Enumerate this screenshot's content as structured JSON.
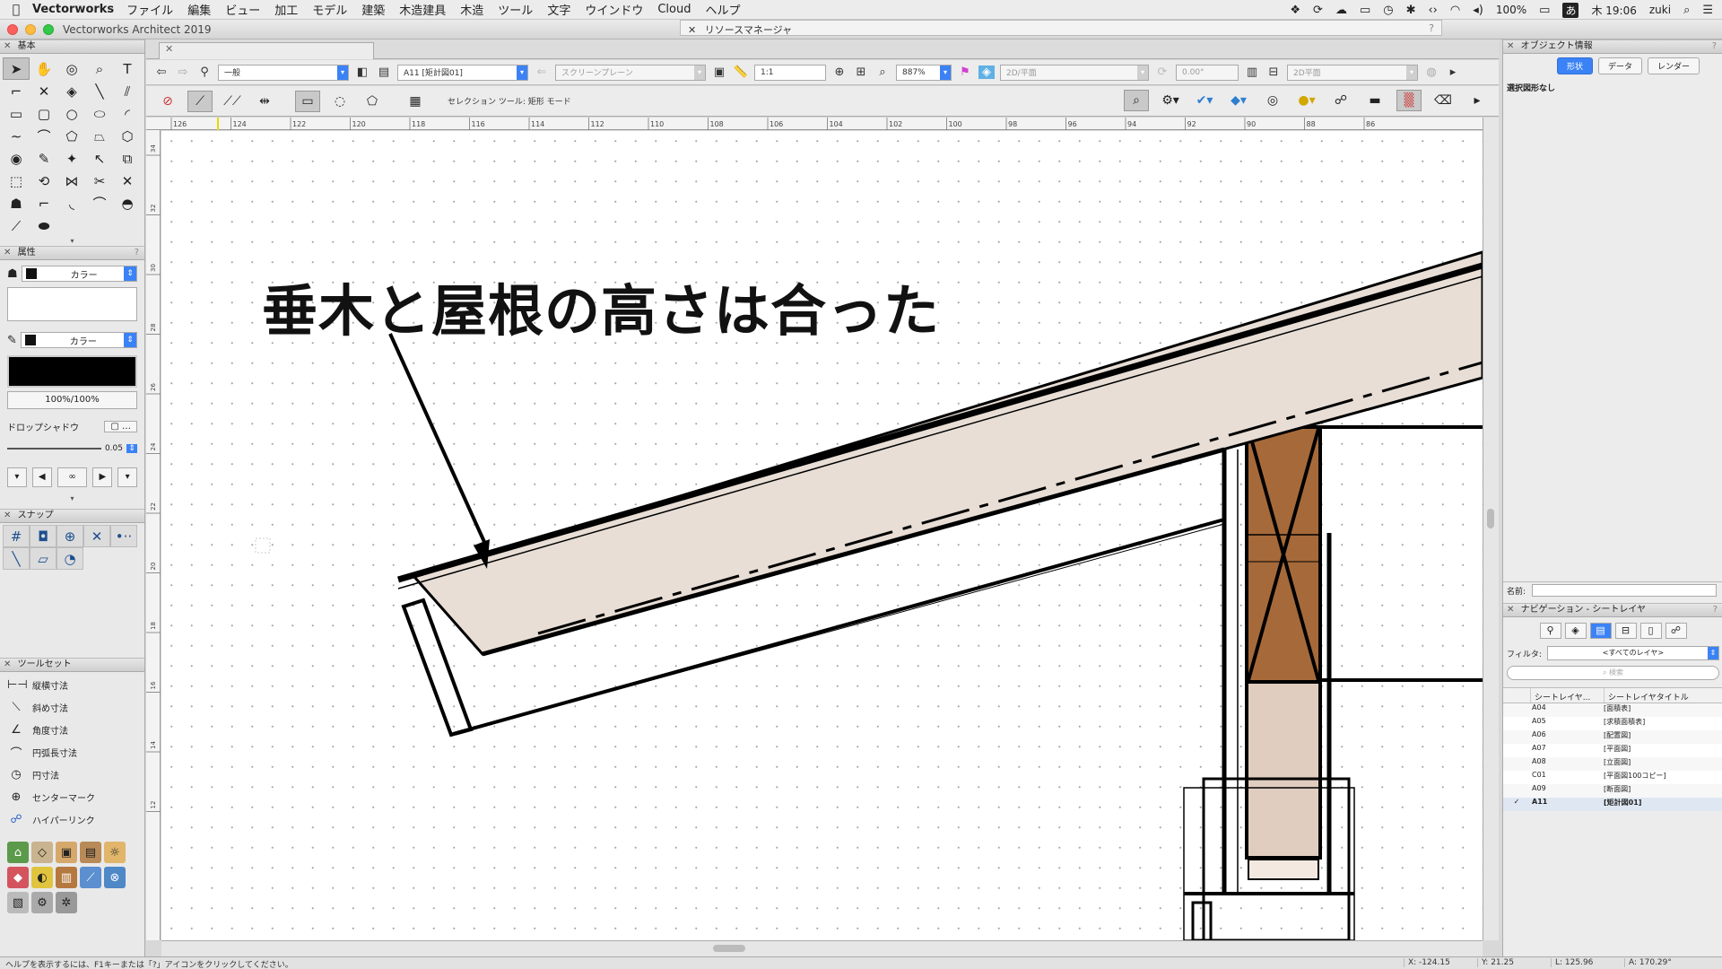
{
  "menubar": {
    "app": "Vectorworks",
    "items": [
      "ファイル",
      "編集",
      "ビュー",
      "加工",
      "モデル",
      "建築",
      "木造建具",
      "木造",
      "ツール",
      "文字",
      "ウインドウ",
      "Cloud",
      "ヘルプ"
    ],
    "battery": "100%",
    "ime": "あ",
    "clock": "木 19:06",
    "user": "zuki"
  },
  "window": {
    "title": "Vectorworks Architect 2019",
    "resource_manager": "リソースマネージャ"
  },
  "left_panel": {
    "basic_title": "基本",
    "attr_title": "属性",
    "fill_style": "カラー",
    "pen_style": "カラー",
    "opacity": "100%/100%",
    "drop_shadow": "ドロップシャドウ",
    "line_weight": "0.05",
    "snap_title": "スナップ",
    "toolset_title": "ツールセット",
    "toolset_items": [
      {
        "icon": "dimension-constrained-icon",
        "label": "縦横寸法"
      },
      {
        "icon": "dimension-unconstrained-icon",
        "label": "斜め寸法"
      },
      {
        "icon": "dimension-angular-icon",
        "label": "角度寸法"
      },
      {
        "icon": "dimension-arc-length-icon",
        "label": "円弧長寸法"
      },
      {
        "icon": "dimension-radial-icon",
        "label": "円寸法"
      },
      {
        "icon": "center-mark-icon",
        "label": "センターマーク"
      },
      {
        "icon": "hyperlink-icon",
        "label": "ハイパーリンク"
      }
    ]
  },
  "view_bar": {
    "class": "一般",
    "layer": "A11 [矩計図01]",
    "plane": "スクリーンプレーン",
    "scale": "1:1",
    "zoom": "887%",
    "view": "2D/平面",
    "rotation": "0.00°",
    "projection": "2D平面"
  },
  "mode_bar": {
    "help": "セレクション ツール: 矩形 モード"
  },
  "rulers": {
    "h_ticks": [
      "126",
      "124",
      "122",
      "120",
      "118",
      "116",
      "114",
      "112",
      "110",
      "108",
      "106",
      "104",
      "102",
      "100",
      "98",
      "96",
      "94",
      "92",
      "90",
      "88",
      "86"
    ],
    "v_ticks": [
      "34",
      "32",
      "30",
      "28",
      "26",
      "24",
      "22",
      "20",
      "18",
      "16",
      "14",
      "12"
    ]
  },
  "annotation": "垂木と屋根の高さは合った",
  "right_panel": {
    "oip_title": "オブジェクト情報",
    "tabs": [
      "形状",
      "データ",
      "レンダー"
    ],
    "no_selection": "選択図形なし",
    "name_label": "名前:",
    "nav_title": "ナビゲーション - シートレイヤ",
    "filter_label": "フィルタ:",
    "filter_value": "<すべてのレイヤ>",
    "search_placeholder": "検索",
    "col_number": "シートレイヤ...",
    "col_title": "シートレイヤタイトル",
    "sheets": [
      {
        "num": "A04",
        "title": "[面積表]",
        "active": false
      },
      {
        "num": "A05",
        "title": "[求積面積表]",
        "active": false
      },
      {
        "num": "A06",
        "title": "[配置図]",
        "active": false
      },
      {
        "num": "A07",
        "title": "[平面図]",
        "active": false
      },
      {
        "num": "A08",
        "title": "[立面図]",
        "active": false
      },
      {
        "num": "C01",
        "title": "[平面図100コピー]",
        "active": false
      },
      {
        "num": "A09",
        "title": "[断面図]",
        "active": false
      },
      {
        "num": "A11",
        "title": "[矩計図01]",
        "active": true
      }
    ]
  },
  "status_bar": {
    "help": "ヘルプを表示するには、F1キーまたは「?」アイコンをクリックしてください。",
    "x": "X: -124.15",
    "y": "Y: 21.25",
    "l": "L: 125.96",
    "a": "A: 170.29°"
  },
  "colors": {
    "accent": "#3b82f6",
    "rafter_fill": "#e8ded6",
    "post_fill": "#a66a3a",
    "wall_fill": "#e0cdbf"
  }
}
